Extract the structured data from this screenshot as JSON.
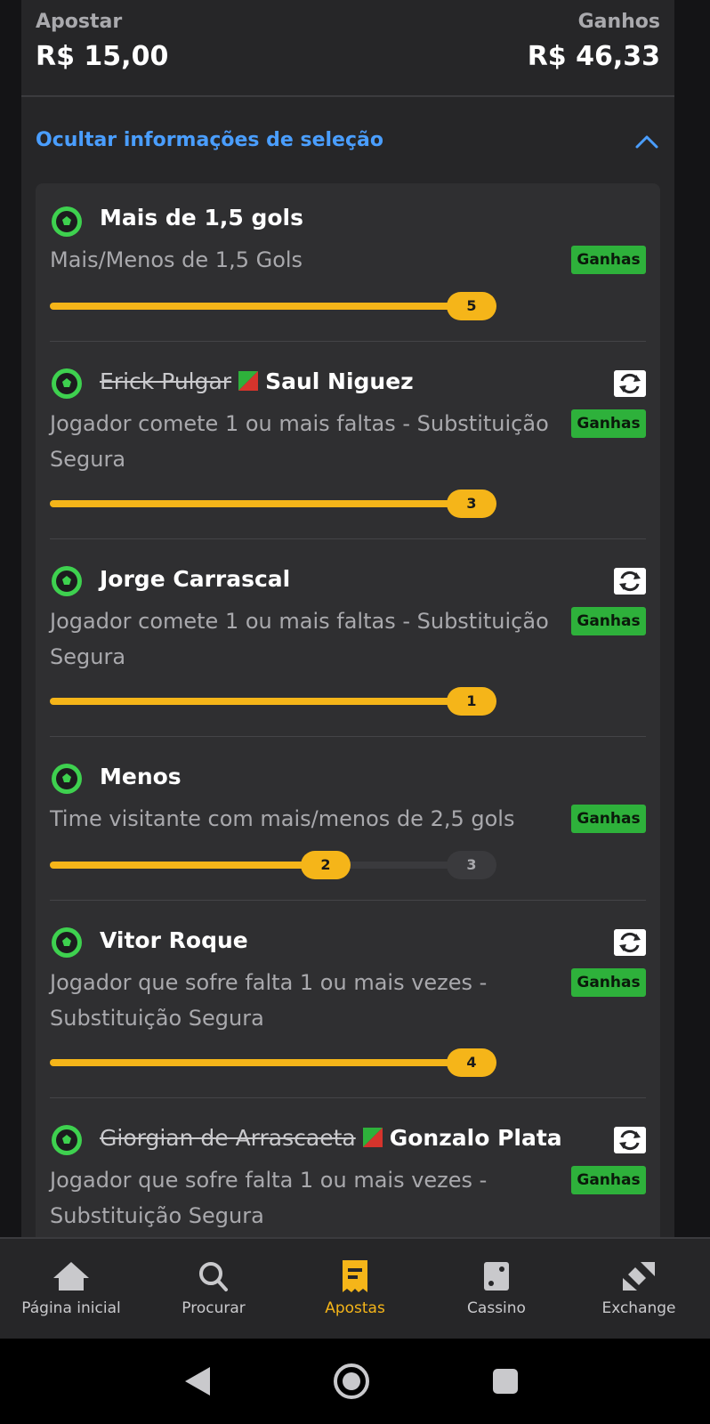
{
  "summary": {
    "stake_label": "Apostar",
    "stake_value": "R$ 15,00",
    "winnings_label": "Ganhos",
    "winnings_value": "R$ 46,33"
  },
  "toggle": {
    "label": "Ocultar informações de seleção",
    "icon": "chevron-up-icon"
  },
  "accent_colors": {
    "link": "#4a9eff",
    "progress": "#f5b519",
    "won_badge": "#2eb13b",
    "ball_icon": "#3ed14f"
  },
  "selections": [
    {
      "title": "Mais de 1,5 gols",
      "description": "Mais/Menos de 1,5 Gols",
      "status": "Ganhas",
      "progress_label": "5",
      "progress_fraction": 1.0
    },
    {
      "replaced_player": "Erick Pulgar",
      "title": "Saul Niguez",
      "description": "Jogador comete 1 ou mais faltas - Substituição Segura",
      "status": "Ganhas",
      "substitution_icon": "swap-icon",
      "progress_label": "3",
      "progress_fraction": 1.0
    },
    {
      "title": "Jorge Carrascal",
      "description": "Jogador comete 1 ou mais faltas - Substituição Segura",
      "status": "Ganhas",
      "substitution_icon": "swap-icon",
      "progress_label": "1",
      "progress_fraction": 1.0
    },
    {
      "title": "Menos",
      "description": "Time visitante com mais/menos de 2,5 gols",
      "status": "Ganhas",
      "progress_label": "2",
      "progress_target_label": "3",
      "progress_fraction": 0.66
    },
    {
      "title": "Vitor Roque",
      "description": "Jogador que sofre falta 1 ou mais vezes - Substituição Segura",
      "status": "Ganhas",
      "substitution_icon": "swap-icon",
      "progress_label": "4",
      "progress_fraction": 1.0
    },
    {
      "replaced_player": "Giorgian de Arrascaeta",
      "title": "Gonzalo Plata",
      "description": "Jogador que sofre falta 1 ou mais vezes - Substituição Segura",
      "status": "Ganhas",
      "substitution_icon": "swap-icon"
    }
  ],
  "nav": {
    "items": [
      {
        "label": "Página inicial",
        "icon": "home-icon"
      },
      {
        "label": "Procurar",
        "icon": "search-icon"
      },
      {
        "label": "Apostas",
        "icon": "bet-slip-icon",
        "active": true
      },
      {
        "label": "Cassino",
        "icon": "dice-icon"
      },
      {
        "label": "Exchange",
        "icon": "exchange-icon"
      }
    ]
  },
  "system_nav": {
    "back": "back-icon",
    "home": "home-circle-icon",
    "recents": "recents-icon"
  }
}
